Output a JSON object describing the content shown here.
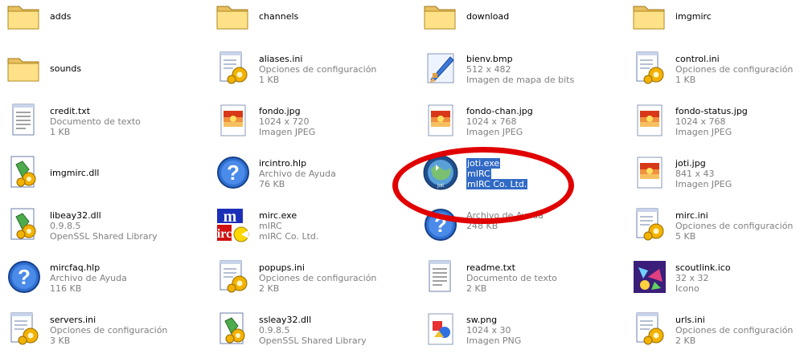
{
  "files": [
    {
      "name": "adds",
      "icon": "folder-icon",
      "details": []
    },
    {
      "name": "channels",
      "icon": "folder-icon",
      "details": []
    },
    {
      "name": "download",
      "icon": "folder-icon",
      "details": []
    },
    {
      "name": "imgmirc",
      "icon": "folder-icon",
      "details": []
    },
    {
      "name": "sounds",
      "icon": "folder-icon",
      "details": []
    },
    {
      "name": "aliases.ini",
      "icon": "config-file-icon",
      "details": [
        "Opciones de configuración",
        "1 KB"
      ]
    },
    {
      "name": "bienv.bmp",
      "icon": "bitmap-paint-icon",
      "details": [
        "512 x 482",
        "Imagen de mapa de bits"
      ]
    },
    {
      "name": "control.ini",
      "icon": "config-file-icon",
      "details": [
        "Opciones de configuración",
        "1 KB"
      ]
    },
    {
      "name": "credit.txt",
      "icon": "text-file-icon",
      "details": [
        "Documento de texto",
        "1 KB"
      ]
    },
    {
      "name": "fondo.jpg",
      "icon": "jpeg-image-icon",
      "details": [
        "1024 x 720",
        "Imagen JPEG"
      ]
    },
    {
      "name": "fondo-chan.jpg",
      "icon": "jpeg-image-icon",
      "details": [
        "1024 x 768",
        "Imagen JPEG"
      ]
    },
    {
      "name": "fondo-status.jpg",
      "icon": "jpeg-image-icon",
      "details": [
        "1024 x 768",
        "Imagen JPEG"
      ]
    },
    {
      "name": "imgmirc.dll",
      "icon": "dll-gear-icon",
      "details": []
    },
    {
      "name": "ircintro.hlp",
      "icon": "help-file-icon",
      "details": [
        "Archivo de Ayuda",
        "76 KB"
      ]
    },
    {
      "name": "joti.exe",
      "icon": "joti-globe-icon",
      "details": [
        "mIRC",
        "mIRC Co. Ltd."
      ],
      "selected": true
    },
    {
      "name": "joti.jpg",
      "icon": "jpeg-image-icon",
      "details": [
        "841 x 43",
        "Imagen JPEG"
      ]
    },
    {
      "name": "libeay32.dll",
      "icon": "dll-gear-icon",
      "details": [
        "0.9.8.5",
        "OpenSSL Shared Library"
      ]
    },
    {
      "name": "mirc.exe",
      "icon": "mirc-app-icon",
      "details": [
        "mIRC",
        "mIRC Co. Ltd."
      ]
    },
    {
      "name": "",
      "icon": "help-file-icon",
      "details": [
        "Archivo de Ayuda",
        "248 KB"
      ]
    },
    {
      "name": "mirc.ini",
      "icon": "config-file-icon",
      "details": [
        "Opciones de configuración",
        "5 KB"
      ]
    },
    {
      "name": "mircfaq.hlp",
      "icon": "help-file-icon",
      "details": [
        "Archivo de Ayuda",
        "116 KB"
      ]
    },
    {
      "name": "popups.ini",
      "icon": "config-file-icon",
      "details": [
        "Opciones de configuración",
        "2 KB"
      ]
    },
    {
      "name": "readme.txt",
      "icon": "text-file-icon",
      "details": [
        "Documento de texto",
        "2 KB"
      ]
    },
    {
      "name": "scoutlink.ico",
      "icon": "scoutlink-icon",
      "details": [
        "32 x 32",
        "Icono"
      ]
    },
    {
      "name": "servers.ini",
      "icon": "config-file-icon",
      "details": [
        "Opciones de configuración",
        "3 KB"
      ]
    },
    {
      "name": "ssleay32.dll",
      "icon": "dll-gear-icon",
      "details": [
        "0.9.8.5",
        "OpenSSL Shared Library"
      ]
    },
    {
      "name": "sw.png",
      "icon": "png-image-icon",
      "details": [
        "1024 x 30",
        "Imagen PNG"
      ]
    },
    {
      "name": "urls.ini",
      "icon": "config-file-icon",
      "details": [
        "Opciones de configuración",
        "2 KB"
      ]
    }
  ],
  "colors": {
    "selection": "#316ac5",
    "highlight_ellipse": "#e00000",
    "meta_text": "#808080"
  }
}
